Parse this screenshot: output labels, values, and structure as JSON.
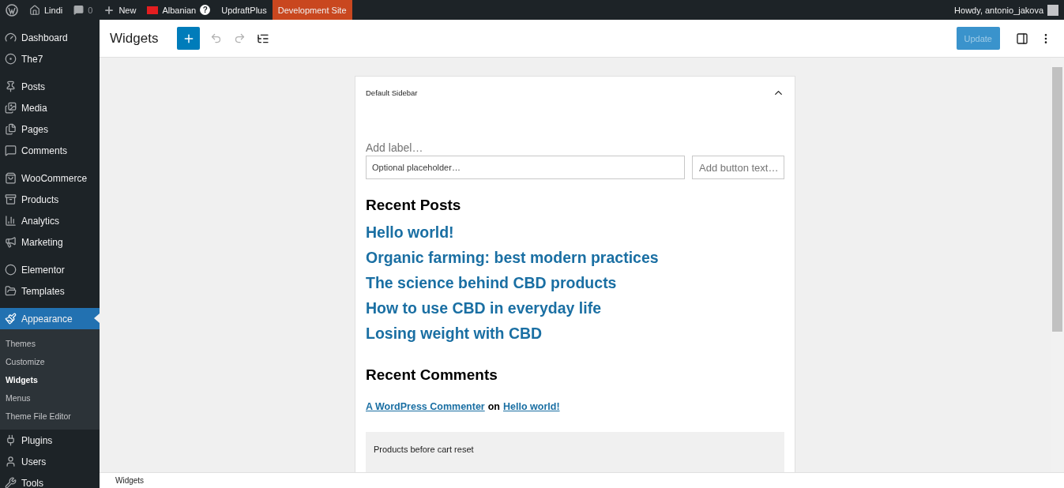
{
  "admin_bar": {
    "items": [
      {
        "kind": "logo"
      },
      {
        "kind": "home",
        "label": "Lindi"
      },
      {
        "kind": "comments",
        "label": "0"
      },
      {
        "kind": "new",
        "label": "New"
      },
      {
        "kind": "flag",
        "label": "Albanian",
        "badge": "?"
      },
      {
        "kind": "text",
        "label": "UpdraftPlus"
      },
      {
        "kind": "highlight",
        "label": "Development Site"
      }
    ],
    "greeting": "Howdy, antonio_jakova"
  },
  "sidebar": {
    "groups": [
      [
        {
          "label": "Dashboard",
          "selected": false
        },
        {
          "label": "The7",
          "selected": false
        }
      ],
      [
        {
          "label": "Posts",
          "selected": false
        },
        {
          "label": "Media",
          "selected": false
        },
        {
          "label": "Pages",
          "selected": false
        },
        {
          "label": "Comments",
          "selected": false
        }
      ],
      [
        {
          "label": "WooCommerce",
          "selected": false
        },
        {
          "label": "Products",
          "selected": false
        },
        {
          "label": "Analytics",
          "selected": false
        },
        {
          "label": "Marketing",
          "selected": false
        }
      ],
      [
        {
          "label": "Elementor",
          "selected": false
        },
        {
          "label": "Templates",
          "selected": false
        }
      ],
      [
        {
          "label": "Appearance",
          "selected": true,
          "children": [
            {
              "label": "Themes",
              "selected": false
            },
            {
              "label": "Customize",
              "selected": false
            },
            {
              "label": "Widgets",
              "selected": true
            },
            {
              "label": "Menus",
              "selected": false
            },
            {
              "label": "Theme File Editor",
              "selected": false
            }
          ]
        },
        {
          "label": "Plugins",
          "selected": false
        },
        {
          "label": "Users",
          "selected": false
        },
        {
          "label": "Tools",
          "selected": false
        }
      ]
    ]
  },
  "header": {
    "title": "Widgets",
    "update_button": {
      "label": "Update",
      "disabled": true
    }
  },
  "widget_area": {
    "title": "Default Sidebar",
    "expanded": true,
    "search": {
      "label": {
        "placeholder": "Add label…"
      },
      "input": {
        "placeholder": "Optional placeholder…"
      },
      "button": {
        "placeholder": "Add button text…"
      }
    },
    "recent_posts": {
      "heading": "Recent Posts",
      "posts": [
        "Hello world!",
        "Organic farming: best modern practices",
        "The science behind CBD products",
        "How to use CBD in everyday life",
        "Losing weight with CBD"
      ]
    },
    "recent_comments": {
      "heading": "Recent Comments",
      "comments": [
        {
          "author": "A WordPress Commenter",
          "connector": "on",
          "post": "Hello world!"
        }
      ]
    },
    "products_block": {
      "title": "Products before cart reset"
    }
  },
  "footer": {
    "breadcrumb": "Widgets"
  }
}
